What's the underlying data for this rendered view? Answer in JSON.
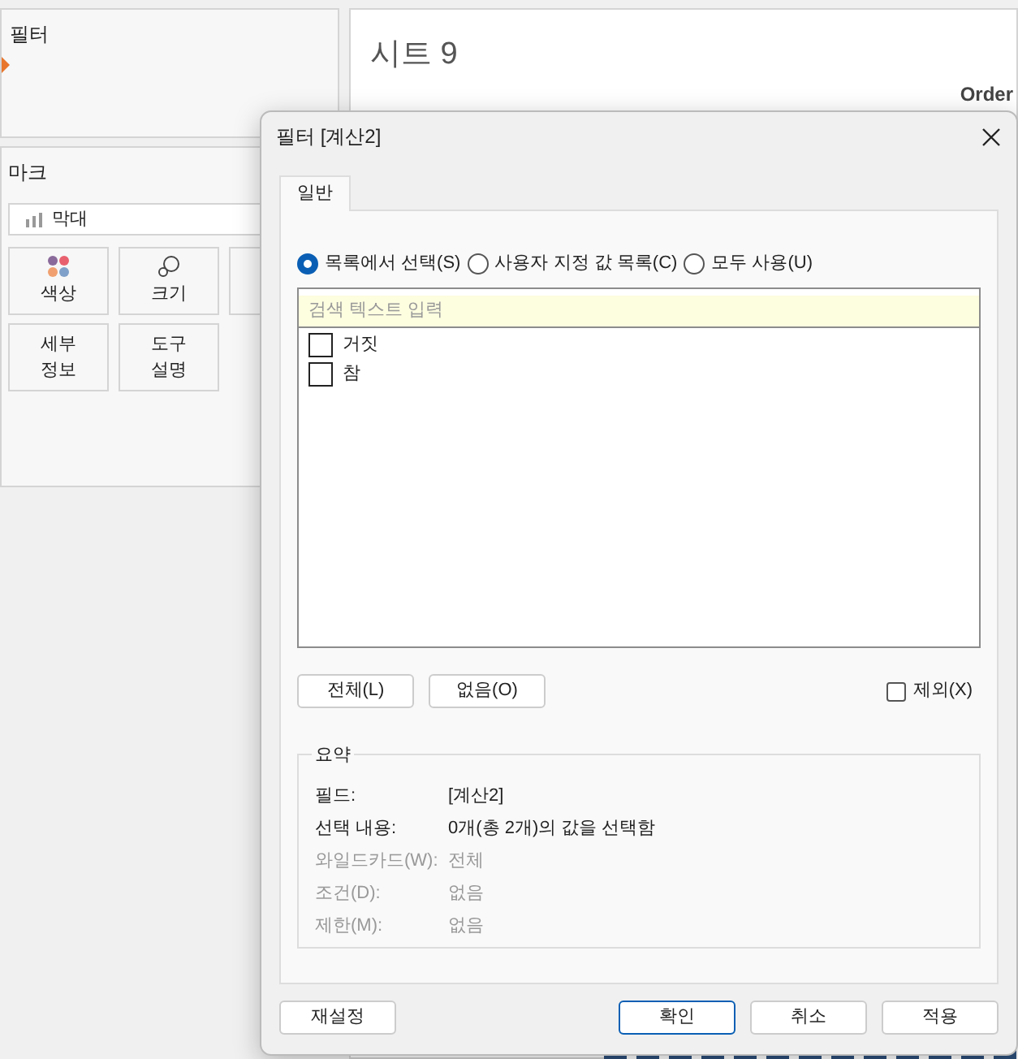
{
  "filters_card": {
    "title": "필터"
  },
  "marks_card": {
    "title": "마크",
    "mark_type": "막대",
    "buttons": [
      {
        "kind": "color",
        "label": "색상"
      },
      {
        "kind": "size",
        "label": "크기"
      },
      {
        "kind": "hidden"
      },
      {
        "kind": "text",
        "label": "세부\n정보"
      },
      {
        "kind": "text",
        "label": "도구\n설명"
      }
    ]
  },
  "sheet": {
    "title": "시트 9",
    "column_header": "Order"
  },
  "dialog": {
    "title": "필터 [계산2]",
    "tabs": [
      {
        "label": "일반",
        "selected": true
      }
    ],
    "radios": [
      {
        "label": "목록에서 선택(S)",
        "selected": true
      },
      {
        "label": "사용자 지정 값 목록(C)",
        "selected": false
      },
      {
        "label": "모두 사용(U)",
        "selected": false
      }
    ],
    "search": {
      "placeholder": "검색 텍스트 입력"
    },
    "items": [
      {
        "label": "거짓",
        "checked": false
      },
      {
        "label": "참",
        "checked": false
      }
    ],
    "list_buttons": [
      "전체(L)",
      "없음(O)"
    ],
    "exclude": {
      "label": "제외(X)",
      "checked": false
    },
    "summary": {
      "title": "요약",
      "rows": [
        {
          "label": "필드:",
          "value": "[계산2]",
          "disabled": false
        },
        {
          "label": "선택 내용:",
          "value": "0개(총 2개)의 값을 선택함",
          "disabled": false
        },
        {
          "label": "와일드카드(W):",
          "value": "전체",
          "disabled": true
        },
        {
          "label": "조건(D):",
          "value": "없음",
          "disabled": true
        },
        {
          "label": "제한(M):",
          "value": "없음",
          "disabled": true
        }
      ]
    },
    "footer_buttons": [
      {
        "label": "재설정",
        "default": false
      },
      {
        "label": "확인",
        "default": true
      },
      {
        "label": "취소",
        "default": false
      },
      {
        "label": "적용",
        "default": false
      }
    ]
  }
}
